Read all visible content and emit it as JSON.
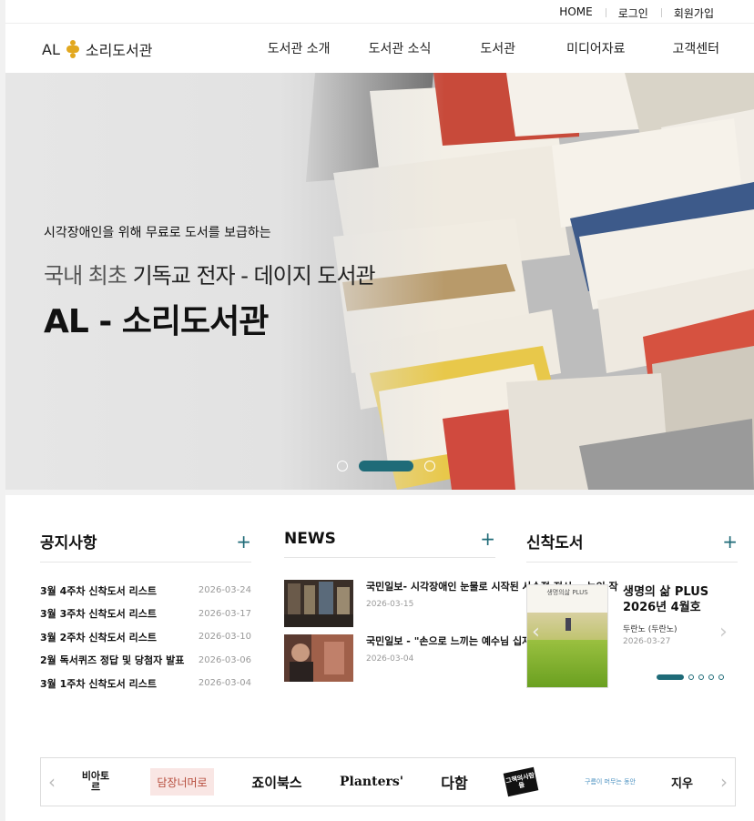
{
  "util": {
    "home": "HOME",
    "login": "로그인",
    "signup": "회원가입"
  },
  "logo": {
    "prefix": "AL",
    "name": "소리도서관"
  },
  "nav": [
    "도서관 소개",
    "도서관 소식",
    "도서관",
    "미디어자료",
    "고객센터"
  ],
  "hero": {
    "sub": "시각장애인을 위해 무료로 도서를 보급하는",
    "line1_dim": "국내 최초",
    "line1_rest": " 기독교 전자 - 데이지 도서관",
    "line2": "AL - 소리도서관",
    "slides": 3,
    "active_slide": 2
  },
  "notice": {
    "title": "공지사항",
    "more": "+",
    "items": [
      {
        "t": "3월 4주차 신착도서 리스트",
        "d": "2026-03-24"
      },
      {
        "t": "3월 3주차 신착도서 리스트",
        "d": "2026-03-17"
      },
      {
        "t": "3월 2주차 신착도서 리스트",
        "d": "2026-03-10"
      },
      {
        "t": "2월 독서퀴즈 정답 및 당첨자 발표",
        "d": "2026-03-06"
      },
      {
        "t": "3월 1주차 신착도서 리스트",
        "d": "2026-03-04"
      }
    ]
  },
  "news": {
    "title": "NEWS",
    "more": "+",
    "items": [
      {
        "t": "국민일보- 시각장애인 눈물로 시작된 사순절 전시... 농인 작",
        "d": "2026-03-15"
      },
      {
        "t": "국민일보 - \"손으로 느끼는 예수님 십자가 사랑",
        "d": "2026-03-04"
      }
    ]
  },
  "newbooks": {
    "title": "신착도서",
    "more": "+",
    "book": {
      "title": "생명의 삶 PLUS 2026년 4월호",
      "author": "두란노 (두란노)",
      "date": "2026-03-27",
      "cover_text": "생명의삶 PLUS"
    },
    "pages": 5,
    "active_page": 1
  },
  "partners": [
    "비아토르",
    "담장너머로",
    "죠이북스",
    "Planters'",
    "다함",
    "그책의사람들",
    "구름이 머무는 동안",
    "지우"
  ],
  "colors": {
    "accent": "#1f6b78",
    "logo": "#e2a81f"
  }
}
